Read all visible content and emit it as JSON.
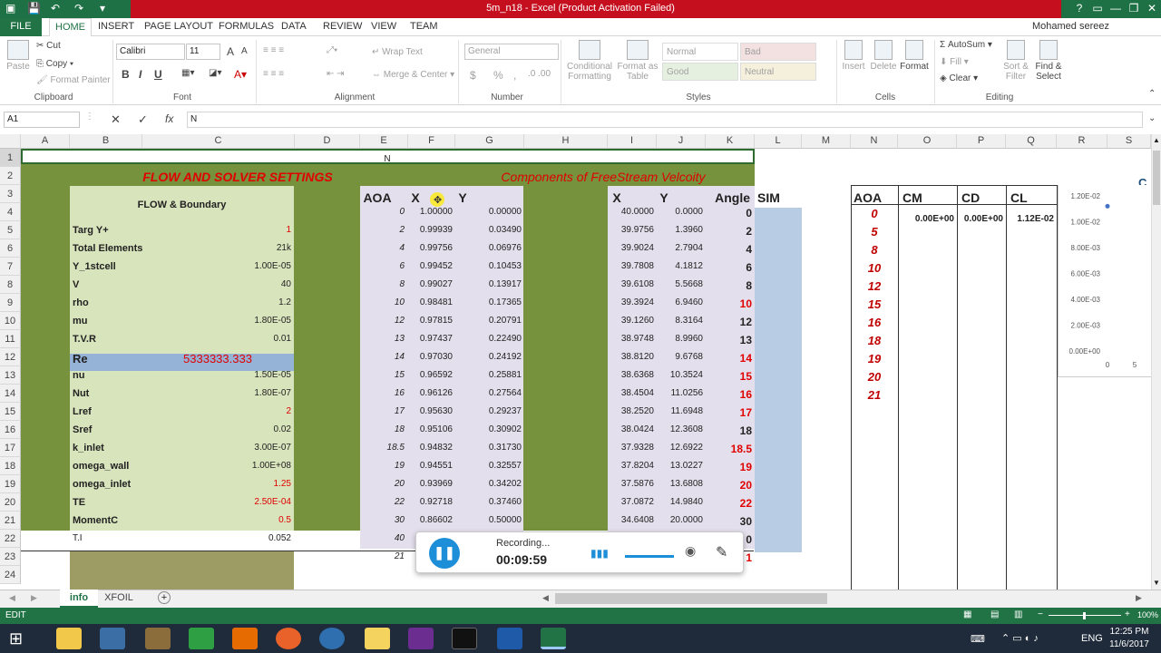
{
  "titlebar": {
    "title": "5m_n18 -  Excel (Product Activation Failed)",
    "help": "?",
    "window_controls": [
      "restore-ribbon",
      "minimize",
      "restore",
      "close"
    ]
  },
  "tabs": [
    "FILE",
    "HOME",
    "INSERT",
    "PAGE LAYOUT",
    "FORMULAS",
    "DATA",
    "REVIEW",
    "VIEW",
    "TEAM"
  ],
  "active_tab": "HOME",
  "user": "Mohamed sereez",
  "ribbon": {
    "clipboard": {
      "paste": "Paste",
      "cut": "Cut",
      "copy": "Copy",
      "format_painter": "Format Painter",
      "group": "Clipboard"
    },
    "font": {
      "name": "Calibri",
      "size": "11",
      "bold": "B",
      "italic": "I",
      "underline": "U",
      "group": "Font",
      "grow": "A",
      "shrink": "A"
    },
    "alignment": {
      "wrap": "Wrap Text",
      "merge": "Merge & Center",
      "group": "Alignment"
    },
    "number": {
      "format": "General",
      "currency": "$",
      "percent": "%",
      "comma": ",",
      "group": "Number"
    },
    "styles": {
      "conditional_1": "Conditional",
      "conditional_2": "Formatting",
      "format_as_1": "Format as",
      "format_as_2": "Table",
      "cell_styles": [
        "Normal",
        "Bad",
        "Good",
        "Neutral"
      ],
      "group": "Styles"
    },
    "cells": {
      "insert": "Insert",
      "delete": "Delete",
      "format": "Format",
      "group": "Cells"
    },
    "editing": {
      "autosum": "AutoSum",
      "fill": "Fill",
      "clear": "Clear",
      "sort_1": "Sort &",
      "sort_2": "Filter",
      "find_1": "Find &",
      "find_2": "Select",
      "group": "Editing"
    }
  },
  "formula_bar": {
    "name_box": "A1",
    "fx": "fx",
    "content": "N"
  },
  "columns": [
    "A",
    "B",
    "C",
    "D",
    "E",
    "F",
    "G",
    "H",
    "I",
    "J",
    "K",
    "L",
    "M",
    "N",
    "O",
    "P",
    "Q",
    "R",
    "S"
  ],
  "rows": [
    "1",
    "2",
    "3",
    "4",
    "5",
    "6",
    "7",
    "8",
    "9",
    "10",
    "11",
    "12",
    "13",
    "14",
    "15",
    "16",
    "17",
    "18",
    "19",
    "20",
    "21",
    "22",
    "23",
    "24"
  ],
  "cells": {
    "a1": "N",
    "flow_title": "FLOW AND SOLVER SETTINGS",
    "components_title": "Components of FreeStream Velcoity",
    "flow_boundary": "FLOW & Boundary",
    "hdr_aoa": "AOA",
    "hdr_x": "X",
    "hdr_y": "Y",
    "hdr_x2": "X",
    "hdr_y2": "Y",
    "hdr_angle": "Angle",
    "hdr_sim": "SIM",
    "hdr_aoa2": "AOA",
    "hdr_cm": "CM",
    "hdr_cd": "CD",
    "hdr_cl": "CL",
    "q_partial": "C"
  },
  "settings": [
    {
      "label": "Targ Y+",
      "value": "1",
      "red": true
    },
    {
      "label": "Total Elements",
      "value": "21k",
      "red": false
    },
    {
      "label": "Y_1stcell",
      "value": "1.00E-05",
      "red": false
    },
    {
      "label": "V",
      "value": "40",
      "red": false
    },
    {
      "label": "rho",
      "value": "1.2",
      "red": false
    },
    {
      "label": "mu",
      "value": "1.80E-05",
      "red": false
    },
    {
      "label": "T.V.R",
      "value": "0.01",
      "red": false
    },
    {
      "label": "Re",
      "value": "5333333.333",
      "red": true
    },
    {
      "label": "nu",
      "value": "1.50E-05",
      "red": false
    },
    {
      "label": "Nut",
      "value": "1.80E-07",
      "red": false
    },
    {
      "label": "Lref",
      "value": "2",
      "red": true
    },
    {
      "label": "Sref",
      "value": "0.02",
      "red": false
    },
    {
      "label": "k_inlet",
      "value": "3.00E-07",
      "red": false
    },
    {
      "label": "omega_wall",
      "value": "1.00E+08",
      "red": false
    },
    {
      "label": "omega_inlet",
      "value": "1.25",
      "red": true
    },
    {
      "label": "TE",
      "value": "2.50E-04",
      "red": true
    },
    {
      "label": "MomentC",
      "value": "0.5",
      "red": true
    },
    {
      "label": "T.I",
      "value": "0.052",
      "red": false
    }
  ],
  "components": [
    {
      "aoa": "0",
      "x": "1.00000",
      "y": "0.00000",
      "x2": "40.0000",
      "y2": "0.0000",
      "angle": "0",
      "angle_red": false
    },
    {
      "aoa": "2",
      "x": "0.99939",
      "y": "0.03490",
      "x2": "39.9756",
      "y2": "1.3960",
      "angle": "2",
      "angle_red": false
    },
    {
      "aoa": "4",
      "x": "0.99756",
      "y": "0.06976",
      "x2": "39.9024",
      "y2": "2.7904",
      "angle": "4",
      "angle_red": false
    },
    {
      "aoa": "6",
      "x": "0.99452",
      "y": "0.10453",
      "x2": "39.7808",
      "y2": "4.1812",
      "angle": "6",
      "angle_red": false
    },
    {
      "aoa": "8",
      "x": "0.99027",
      "y": "0.13917",
      "x2": "39.6108",
      "y2": "5.5668",
      "angle": "8",
      "angle_red": false
    },
    {
      "aoa": "10",
      "x": "0.98481",
      "y": "0.17365",
      "x2": "39.3924",
      "y2": "6.9460",
      "angle": "10",
      "angle_red": true
    },
    {
      "aoa": "12",
      "x": "0.97815",
      "y": "0.20791",
      "x2": "39.1260",
      "y2": "8.3164",
      "angle": "12",
      "angle_red": false
    },
    {
      "aoa": "13",
      "x": "0.97437",
      "y": "0.22490",
      "x2": "38.9748",
      "y2": "8.9960",
      "angle": "13",
      "angle_red": false
    },
    {
      "aoa": "14",
      "x": "0.97030",
      "y": "0.24192",
      "x2": "38.8120",
      "y2": "9.6768",
      "angle": "14",
      "angle_red": true
    },
    {
      "aoa": "15",
      "x": "0.96592",
      "y": "0.25881",
      "x2": "38.6368",
      "y2": "10.3524",
      "angle": "15",
      "angle_red": true
    },
    {
      "aoa": "16",
      "x": "0.96126",
      "y": "0.27564",
      "x2": "38.4504",
      "y2": "11.0256",
      "angle": "16",
      "angle_red": true
    },
    {
      "aoa": "17",
      "x": "0.95630",
      "y": "0.29237",
      "x2": "38.2520",
      "y2": "11.6948",
      "angle": "17",
      "angle_red": true
    },
    {
      "aoa": "18",
      "x": "0.95106",
      "y": "0.30902",
      "x2": "38.0424",
      "y2": "12.3608",
      "angle": "18",
      "angle_red": false
    },
    {
      "aoa": "18.5",
      "x": "0.94832",
      "y": "0.31730",
      "x2": "37.9328",
      "y2": "12.6922",
      "angle": "18.5",
      "angle_red": true
    },
    {
      "aoa": "19",
      "x": "0.94551",
      "y": "0.32557",
      "x2": "37.8204",
      "y2": "13.0227",
      "angle": "19",
      "angle_red": true
    },
    {
      "aoa": "20",
      "x": "0.93969",
      "y": "0.34202",
      "x2": "37.5876",
      "y2": "13.6808",
      "angle": "20",
      "angle_red": true
    },
    {
      "aoa": "22",
      "x": "0.92718",
      "y": "0.37460",
      "x2": "37.0872",
      "y2": "14.9840",
      "angle": "22",
      "angle_red": true
    },
    {
      "aoa": "30",
      "x": "0.86602",
      "y": "0.50000",
      "x2": "34.6408",
      "y2": "20.0000",
      "angle": "30",
      "angle_red": false
    },
    {
      "aoa": "40",
      "x": "",
      "y": "",
      "x2": "",
      "y2": "",
      "angle": "0",
      "angle_red": false
    },
    {
      "aoa": "21",
      "x": "",
      "y": "",
      "x2": "",
      "y2": "",
      "angle": "1",
      "angle_red": true
    }
  ],
  "results": {
    "aoa": [
      "0",
      "5",
      "8",
      "10",
      "12",
      "15",
      "16",
      "18",
      "19",
      "20",
      "21"
    ],
    "row4": {
      "cm": "0.00E+00",
      "cd": "0.00E+00",
      "cl": "1.12E-02"
    }
  },
  "mini_chart": {
    "y_ticks": [
      "1.20E-02",
      "1.00E-02",
      "8.00E-03",
      "6.00E-03",
      "4.00E-03",
      "2.00E-03",
      "0.00E+00"
    ],
    "x_ticks": [
      "0",
      "5"
    ],
    "point": {
      "x": 0,
      "y": 0.0112
    }
  },
  "sheet_tabs": [
    "info",
    "XFOIL"
  ],
  "active_sheet": "info",
  "status": {
    "mode": "EDIT",
    "zoom": "100%"
  },
  "recorder": {
    "status": "Recording...",
    "time": "00:09:59"
  },
  "taskbar": {
    "lang": "ENG",
    "time": "12:25 PM",
    "date": "11/6/2017"
  }
}
